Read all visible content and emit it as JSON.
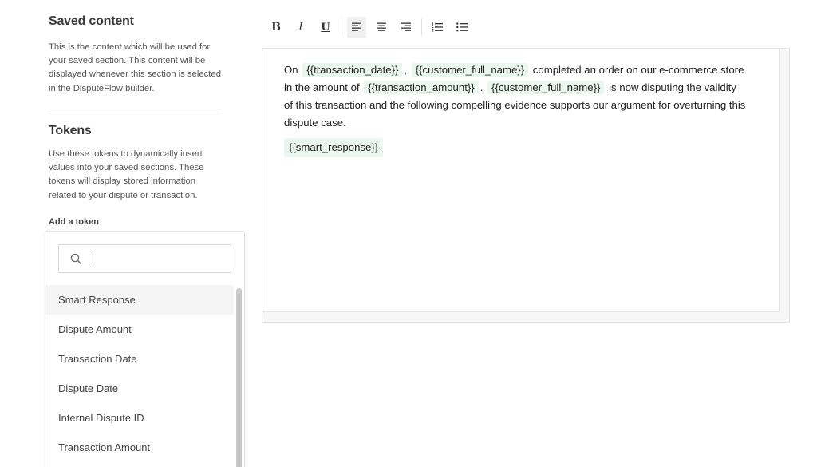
{
  "saved_content": {
    "title": "Saved content",
    "description": "This is the content which will be used for your saved section. This content will be displayed whenever this section is selected in the DisputeFlow builder."
  },
  "tokens_section": {
    "title": "Tokens",
    "description": "Use these tokens to dynamically insert values into your saved sections. These tokens will display stored information related to your dispute or transaction.",
    "add_token_label": "Add a token",
    "search": {
      "value": "",
      "placeholder": ""
    },
    "items": [
      {
        "label": "Smart Response",
        "active": true
      },
      {
        "label": "Dispute Amount"
      },
      {
        "label": "Transaction Date"
      },
      {
        "label": "Dispute Date"
      },
      {
        "label": "Internal Dispute ID"
      },
      {
        "label": "Transaction Amount"
      }
    ]
  },
  "toolbar": {
    "bold": "B",
    "italic": "I",
    "underline": "U",
    "icons": [
      "bold-icon",
      "italic-icon",
      "underline-icon",
      "align-left-icon",
      "align-center-icon",
      "align-right-icon",
      "ordered-list-icon",
      "bullet-list-icon"
    ],
    "active": "align-left"
  },
  "editor": {
    "text_1": "On",
    "token_1": "{{transaction_date}}",
    "text_2": ",",
    "token_2": "{{customer_full_name}}",
    "text_3": "completed an order on our e-commerce store in the amount of",
    "token_3": "{{transaction_amount}}",
    "text_4": ".",
    "token_4": "{{customer_full_name}}",
    "text_5": "is now disputing the validity of this transaction and the following compelling evidence supports our argument for overturning this dispute case.",
    "smart_token": "{{smart_response}}"
  },
  "colors": {
    "token_bg": "#eaf7ef",
    "active_item_bg": "#f5f5f5"
  }
}
